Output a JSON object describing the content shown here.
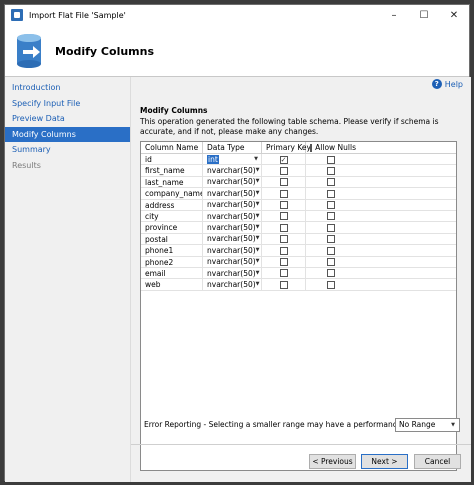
{
  "window": {
    "title": "Import Flat File 'Sample'"
  },
  "header": {
    "title": "Modify Columns"
  },
  "sidebar": {
    "items": [
      {
        "label": "Introduction",
        "state": "link"
      },
      {
        "label": "Specify Input File",
        "state": "link"
      },
      {
        "label": "Preview Data",
        "state": "link"
      },
      {
        "label": "Modify Columns",
        "state": "active"
      },
      {
        "label": "Summary",
        "state": "link"
      },
      {
        "label": "Results",
        "state": "disabled"
      }
    ]
  },
  "help": {
    "label": "Help"
  },
  "section": {
    "title": "Modify Columns",
    "description": "This operation generated the following table schema. Please verify if schema is accurate, and if not, please make any changes."
  },
  "grid": {
    "headers": {
      "name": "Column Name",
      "type": "Data Type",
      "pk": "Primary Key",
      "nulls": "Allow Nulls"
    },
    "rows": [
      {
        "name": "id",
        "type": "int",
        "pk": true,
        "nulls": false
      },
      {
        "name": "first_name",
        "type": "nvarchar(50)",
        "pk": false,
        "nulls": false
      },
      {
        "name": "last_name",
        "type": "nvarchar(50)",
        "pk": false,
        "nulls": false
      },
      {
        "name": "company_name",
        "type": "nvarchar(50)",
        "pk": false,
        "nulls": false
      },
      {
        "name": "address",
        "type": "nvarchar(50)",
        "pk": false,
        "nulls": false
      },
      {
        "name": "city",
        "type": "nvarchar(50)",
        "pk": false,
        "nulls": false
      },
      {
        "name": "province",
        "type": "nvarchar(50)",
        "pk": false,
        "nulls": false
      },
      {
        "name": "postal",
        "type": "nvarchar(50)",
        "pk": false,
        "nulls": false
      },
      {
        "name": "phone1",
        "type": "nvarchar(50)",
        "pk": false,
        "nulls": false
      },
      {
        "name": "phone2",
        "type": "nvarchar(50)",
        "pk": false,
        "nulls": false
      },
      {
        "name": "email",
        "type": "nvarchar(50)",
        "pk": false,
        "nulls": false
      },
      {
        "name": "web",
        "type": "nvarchar(50)",
        "pk": false,
        "nulls": false
      }
    ]
  },
  "error_reporting": {
    "label": "Error Reporting - Selecting a smaller range may have a performance impact",
    "selected": "No Range"
  },
  "buttons": {
    "previous": "< Previous",
    "next": "Next >",
    "cancel": "Cancel"
  },
  "colors": {
    "accent": "#2a6fc6",
    "link": "#1c5fb5"
  }
}
